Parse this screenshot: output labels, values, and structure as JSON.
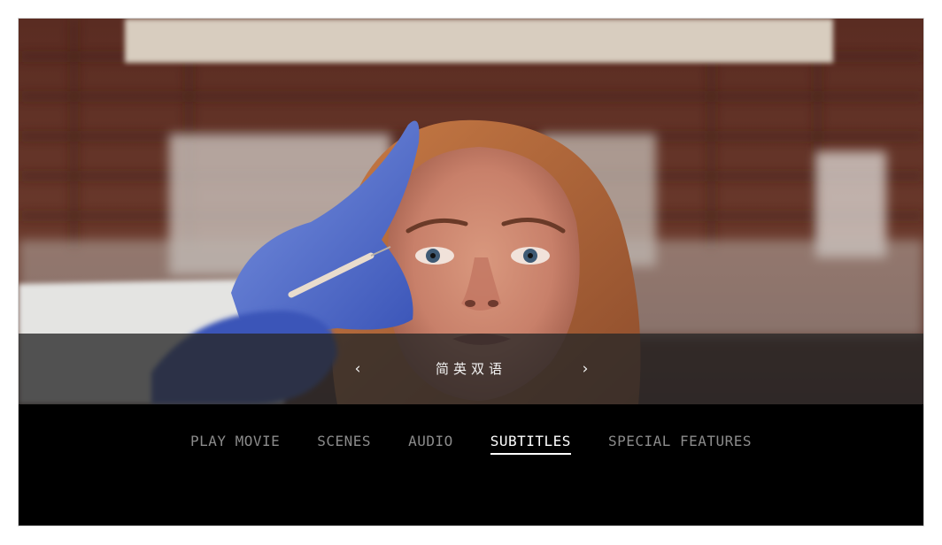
{
  "player": {
    "scene_description_icon": "video-frame",
    "subtitle_selector": {
      "prev_glyph": "‹",
      "next_glyph": "›",
      "current_value": "简英双语"
    },
    "menu": {
      "items": [
        {
          "label": "PLAY MOVIE",
          "active": false
        },
        {
          "label": "SCENES",
          "active": false
        },
        {
          "label": "AUDIO",
          "active": false
        },
        {
          "label": "SUBTITLES",
          "active": true
        },
        {
          "label": "SPECIAL FEATURES",
          "active": false
        }
      ]
    }
  },
  "colors": {
    "menu_inactive": "#8b8b8b",
    "menu_active": "#ffffff",
    "band": "#282828",
    "background": "#000000"
  }
}
